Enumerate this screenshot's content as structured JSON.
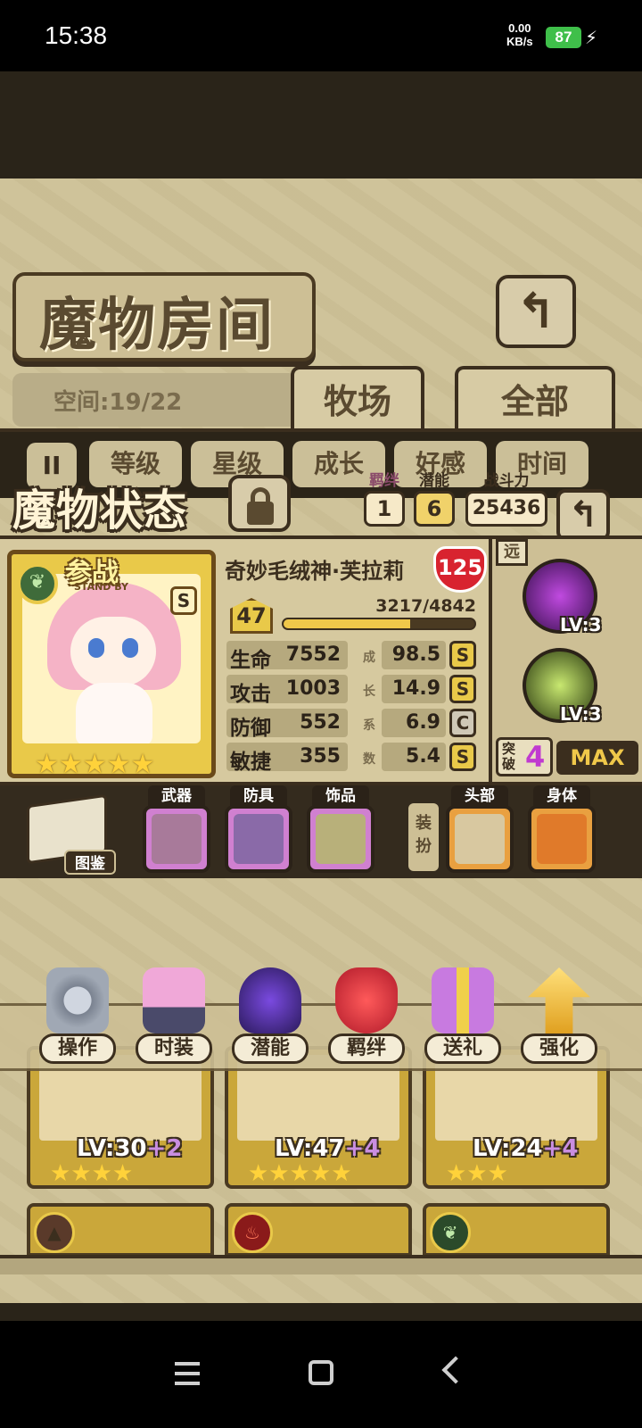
{
  "status_bar": {
    "time": "15:38",
    "net_speed_value": "0.00",
    "net_speed_unit": "KB/s",
    "battery": "87"
  },
  "header": {
    "title": "魔物房间",
    "space": "空间:19/22",
    "tabs": [
      {
        "label": "牧场"
      },
      {
        "label": "全部"
      }
    ]
  },
  "sort_bar": {
    "buttons": [
      {
        "label": "等级"
      },
      {
        "label": "星级"
      },
      {
        "label": "成长"
      },
      {
        "label": "好感"
      },
      {
        "label": "时间"
      }
    ]
  },
  "status": {
    "title": "魔物状态",
    "bond_label": "羁绊",
    "bond_value": "1",
    "potential_label": "潜能",
    "potential_value": "6",
    "power_label": "战斗力",
    "power_value": "25436"
  },
  "monster": {
    "standby": "参战",
    "standby_sub": "STAND BY",
    "rank": "S",
    "star_count": 5,
    "name": "奇妙毛绒神·芙拉莉",
    "affection": "125",
    "level": "47",
    "exp_text": "3217/4842",
    "exp_fraction": 0.664,
    "stats": [
      {
        "name": "生命",
        "value": "7552",
        "growth": "98.5",
        "grade": "S"
      },
      {
        "name": "攻击",
        "value": "1003",
        "growth": "14.9",
        "grade": "S"
      },
      {
        "name": "防御",
        "value": "552",
        "growth": "6.9",
        "grade": "C"
      },
      {
        "name": "敏捷",
        "value": "355",
        "growth": "5.4",
        "grade": "S"
      }
    ],
    "growth_label_chars": [
      "成",
      "长",
      "系",
      "数"
    ]
  },
  "skills": {
    "range": "远",
    "items": [
      {
        "lv": "LV:3"
      },
      {
        "lv": "LV:3"
      }
    ],
    "breakthrough_label": "突破",
    "breakthrough_value": "4",
    "max_label": "MAX"
  },
  "equipment": {
    "book_label": "图鉴",
    "dress_label": "装扮",
    "slots": [
      {
        "label": "武器"
      },
      {
        "label": "防具"
      },
      {
        "label": "饰品"
      },
      {
        "label": "头部"
      },
      {
        "label": "身体"
      }
    ]
  },
  "actions": [
    {
      "label": "操作"
    },
    {
      "label": "时装"
    },
    {
      "label": "潜能"
    },
    {
      "label": "羁绊"
    },
    {
      "label": "送礼"
    },
    {
      "label": "强化"
    }
  ],
  "cards": [
    {
      "lv": "LV:30",
      "plus": "+2",
      "stars": 4
    },
    {
      "lv": "LV:47",
      "plus": "+4",
      "stars": 5
    },
    {
      "lv": "LV:24",
      "plus": "+4",
      "stars": 3
    }
  ],
  "colors": {
    "accent_gold": "#e9c949",
    "exp_fill": "#f0c84a",
    "affection_red": "#d8232f",
    "breakthrough_purple": "#c03ad0"
  }
}
